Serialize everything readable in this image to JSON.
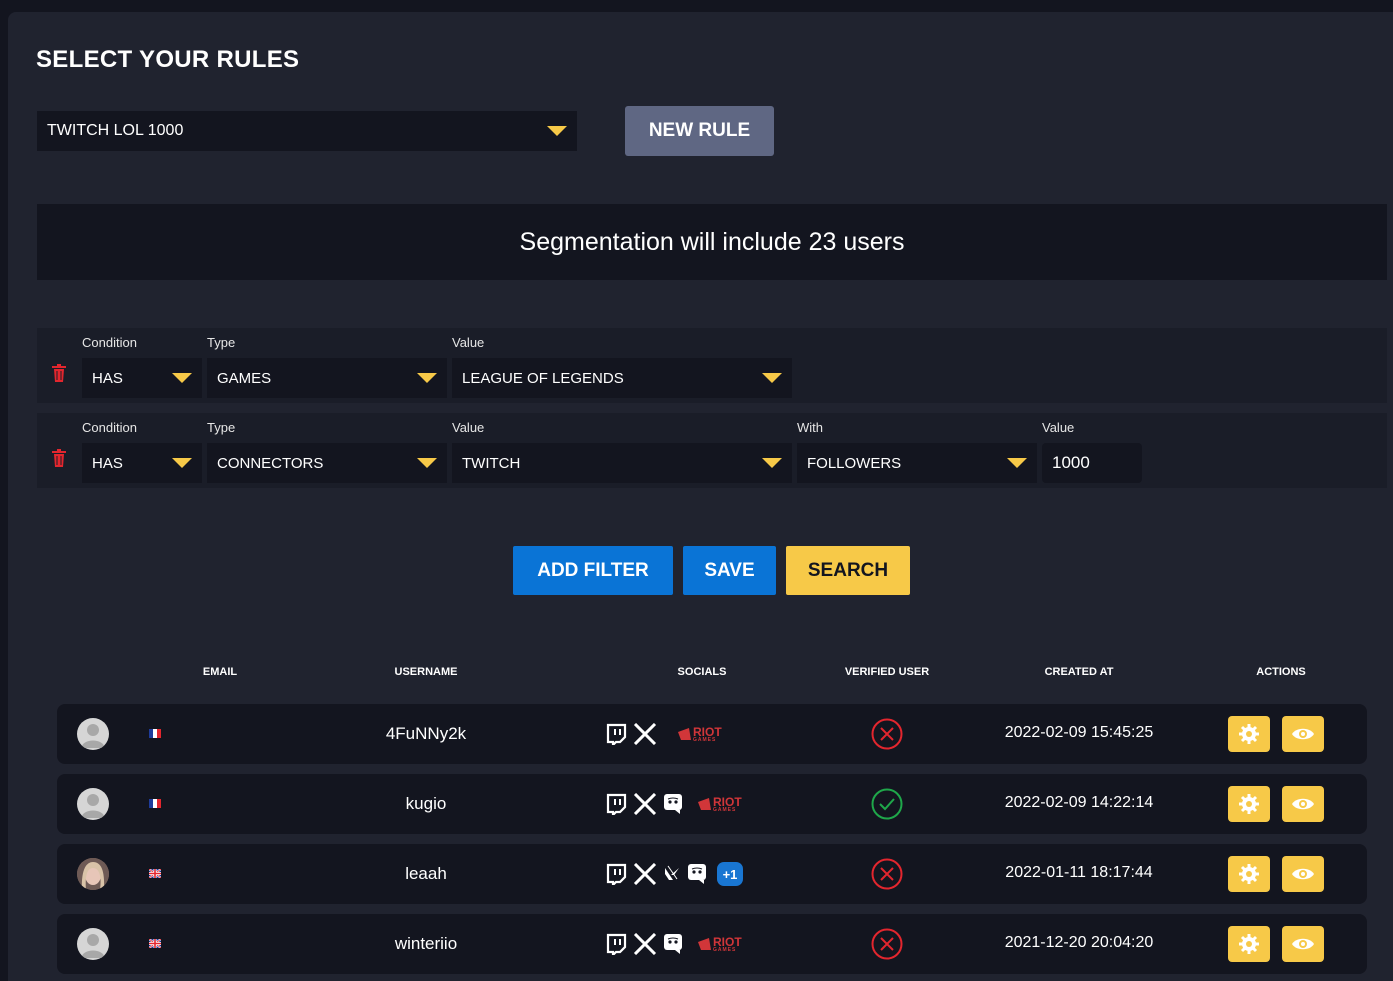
{
  "header": {
    "title": "SELECT YOUR RULES"
  },
  "rule_select": {
    "value": "TWITCH LOL 1000"
  },
  "new_rule_label": "NEW RULE",
  "banner": {
    "text": "Segmentation will include 23 users"
  },
  "filters": [
    {
      "condition_label": "Condition",
      "condition": "HAS",
      "type_label": "Type",
      "type": "GAMES",
      "value_label": "Value",
      "value": "LEAGUE OF LEGENDS"
    },
    {
      "condition_label": "Condition",
      "condition": "HAS",
      "type_label": "Type",
      "type": "CONNECTORS",
      "value_label": "Value",
      "value": "TWITCH",
      "with_label": "With",
      "with": "FOLLOWERS",
      "value2_label": "Value",
      "value2": "1000"
    }
  ],
  "buttons": {
    "add_filter": "ADD FILTER",
    "save": "SAVE",
    "search": "SEARCH"
  },
  "table": {
    "columns": [
      "EMAIL",
      "USERNAME",
      "SOCIALS",
      "VERIFIED USER",
      "CREATED AT",
      "ACTIONS"
    ],
    "rows": [
      {
        "username": "4FuNNy2k",
        "created_at": "2022-02-09 15:45:25",
        "verified": false,
        "flag": "fr",
        "socials": [
          "twitch-icon",
          "x-icon",
          "riot-games-logo"
        ]
      },
      {
        "username": "kugio",
        "created_at": "2022-02-09 14:22:14",
        "verified": true,
        "flag": "fr",
        "socials": [
          "twitch-icon",
          "x-icon",
          "discord-icon",
          "riot-games-logo"
        ]
      },
      {
        "username": "leaah",
        "created_at": "2022-01-11 18:17:44",
        "verified": false,
        "flag": "gb",
        "socials": [
          "twitch-icon",
          "x-icon",
          "valorant-icon",
          "discord-icon",
          "more-badge"
        ],
        "more": "+1"
      },
      {
        "username": "winteriio",
        "created_at": "2021-12-20 20:04:20",
        "verified": false,
        "flag": "gb",
        "socials": [
          "twitch-icon",
          "x-icon",
          "discord-icon",
          "riot-games-logo"
        ]
      }
    ]
  },
  "riot_logo": {
    "word": "RIOT",
    "sub": "GAMES"
  },
  "colors": {
    "background": "#13151f",
    "panel": "#20232f",
    "accent_yellow": "#f7c948",
    "blue": "#0a74d6",
    "new_rule": "#5f6783",
    "error_red": "#e3262e",
    "success_green": "#1fa74a"
  }
}
